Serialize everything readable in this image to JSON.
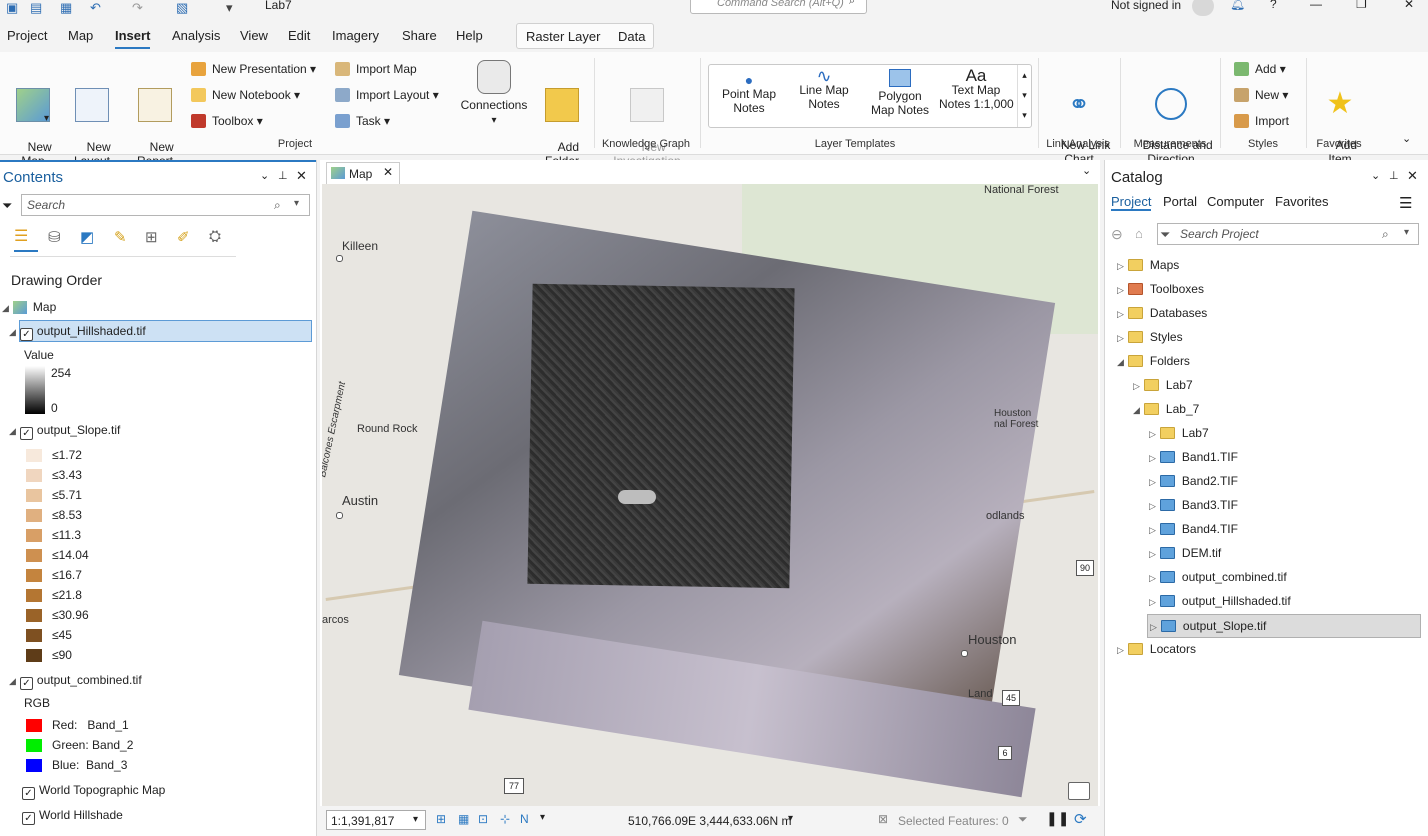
{
  "titlebar": {
    "doc_name": "Lab7",
    "cmd_search_placeholder": "Command Search (Alt+Q)",
    "signin": "Not signed in"
  },
  "menu": {
    "tabs": [
      "Project",
      "Map",
      "Insert",
      "Analysis",
      "View",
      "Edit",
      "Imagery",
      "Share",
      "Help"
    ],
    "active": "Insert",
    "context_tabs": [
      "Raster Layer",
      "Data"
    ]
  },
  "ribbon": {
    "new_map": "New\nMap",
    "new_layout": "New\nLayout",
    "new_report": "New\nReport",
    "new_presentation": "New Presentation",
    "new_notebook": "New Notebook",
    "toolbox": "Toolbox",
    "import_map": "Import Map",
    "import_layout": "Import Layout",
    "task": "Task",
    "connections": "Connections",
    "add_folder": "Add\nFolder",
    "new_investigation": "New\nInvestigation",
    "point_map_notes": "Point Map\nNotes",
    "line_map_notes": "Line Map\nNotes",
    "polygon_map_notes": "Polygon\nMap Notes",
    "text_map_notes": "Text Map\nNotes 1:1,000",
    "new_link_chart": "New Link\nChart",
    "distance_direction": "Distance and\nDirection",
    "styles_add": "Add",
    "styles_new": "New",
    "styles_import": "Import",
    "add_item": "Add\nItem",
    "groups": {
      "project": "Project",
      "knowledge": "Knowledge Graph",
      "layer_templates": "Layer Templates",
      "link_analysis": "Link Analysis",
      "measurements": "Measurements",
      "styles": "Styles",
      "favorites": "Favorites"
    }
  },
  "contents": {
    "title": "Contents",
    "search_placeholder": "Search",
    "drawing_order": "Drawing Order",
    "map_name": "Map",
    "hillshade": {
      "name": "output_Hillshaded.tif",
      "value_label": "Value",
      "high": "254",
      "low": "0"
    },
    "slope": {
      "name": "output_Slope.tif",
      "classes": [
        {
          "label": "≤1.72",
          "color": "#f7e9dc"
        },
        {
          "label": "≤3.43",
          "color": "#f0d6bf"
        },
        {
          "label": "≤5.71",
          "color": "#e9c59f"
        },
        {
          "label": "≤8.53",
          "color": "#e0b080"
        },
        {
          "label": "≤11.3",
          "color": "#d89f66"
        },
        {
          "label": "≤14.04",
          "color": "#ce9050"
        },
        {
          "label": "≤16.7",
          "color": "#c4843e"
        },
        {
          "label": "≤21.8",
          "color": "#b47632"
        },
        {
          "label": "≤30.96",
          "color": "#9a6328"
        },
        {
          "label": "≤45",
          "color": "#7e5021"
        },
        {
          "label": "≤90",
          "color": "#5e3c18"
        }
      ]
    },
    "combined": {
      "name": "output_combined.tif",
      "rgb_label": "RGB",
      "bands": [
        {
          "label": "Red:   Band_1",
          "color": "#ff0000"
        },
        {
          "label": "Green: Band_2",
          "color": "#00ee00"
        },
        {
          "label": "Blue:  Band_3",
          "color": "#0000ff"
        }
      ]
    },
    "basemaps": [
      "World Topographic Map",
      "World Hillshade"
    ]
  },
  "map": {
    "tab_label": "Map",
    "cities": [
      "National Forest",
      "Killeen",
      "Round Rock",
      "Balcones Escarpment",
      "Austin",
      "Houston",
      "Houston\nnal Forest",
      "odlands",
      "arcos",
      "Land"
    ],
    "highways": [
      "90",
      "45",
      "6",
      "77"
    ],
    "scale": "1:1,391,817",
    "coords": "510,766.09E 3,444,633.06N m",
    "selected_features": "Selected Features: 0"
  },
  "catalog": {
    "title": "Catalog",
    "tabs": [
      "Project",
      "Portal",
      "Computer",
      "Favorites"
    ],
    "search_placeholder": "Search Project",
    "items": [
      "Maps",
      "Toolboxes",
      "Databases",
      "Styles",
      "Folders"
    ],
    "folders": {
      "lab7_top": "Lab7",
      "lab_7": "Lab_7",
      "lab7_inner": "Lab7"
    },
    "files": [
      "Band1.TIF",
      "Band2.TIF",
      "Band3.TIF",
      "Band4.TIF",
      "DEM.tif",
      "output_combined.tif",
      "output_Hillshaded.tif",
      "output_Slope.tif"
    ],
    "locators": "Locators"
  }
}
